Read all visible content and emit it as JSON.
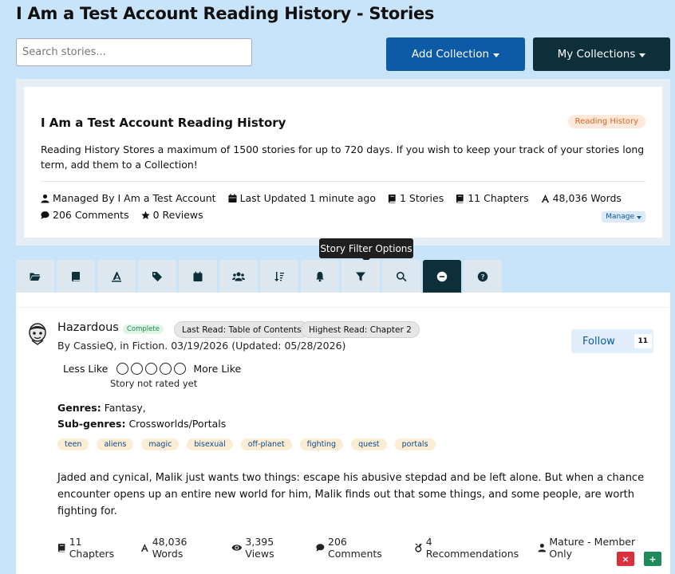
{
  "header": {
    "title": "I Am a Test Account Reading History - Stories",
    "search_placeholder": "Search stories...",
    "add_collection_label": "Add Collection",
    "my_collections_label": "My Collections"
  },
  "collection": {
    "title": "I Am a Test Account Reading History",
    "badge": "Reading History",
    "description": "Reading History Stores a maximum of 1500 stories for up to 720 days.  If you wish to keep your track of your stories long term, add them to a Collection!",
    "meta": {
      "managed_by": "Managed By I Am a Test Account",
      "last_updated": "Last Updated 1 minute ago",
      "stories": "1 Stories",
      "chapters": "11 Chapters",
      "words": "48,036 Words",
      "comments": "206 Comments",
      "reviews": "0 Reviews"
    },
    "manage_label": "Manage"
  },
  "tooltip": "Story Filter Options",
  "tabs": [
    {
      "name": "folder-icon",
      "active": false
    },
    {
      "name": "book-icon",
      "active": false
    },
    {
      "name": "quill-icon",
      "active": false
    },
    {
      "name": "tags-icon",
      "active": false
    },
    {
      "name": "calendar-icon",
      "active": false
    },
    {
      "name": "users-icon",
      "active": false
    },
    {
      "name": "sort-icon",
      "active": false
    },
    {
      "name": "bell-icon",
      "active": false
    },
    {
      "name": "filter-icon",
      "active": false
    },
    {
      "name": "search-icon",
      "active": false
    },
    {
      "name": "minus-circle-icon",
      "active": true
    },
    {
      "name": "help-icon",
      "active": false
    }
  ],
  "story": {
    "title": "Hazardous",
    "status": "Complete",
    "last_read": "Last Read: Table of Contents",
    "highest_read": "Highest Read: Chapter 2",
    "byline": "By CassieQ, in Fiction. 03/19/2026 (Updated: 05/28/2026)",
    "follow_label": "Follow",
    "follow_count": "11",
    "rating": {
      "less_like": "Less Like",
      "more_like": "More Like",
      "note": "Story not rated yet"
    },
    "genres_label": "Genres:",
    "genres_value": "Fantasy,",
    "subgenres_label": "Sub-genres:",
    "subgenres_value": "Crossworlds/Portals",
    "tags": [
      "teen",
      "aliens",
      "magic",
      "bisexual",
      "off-planet",
      "fighting",
      "quest",
      "portals"
    ],
    "synopsis": "Jaded and cynical, Malik just wants two things: escape his abusive stepdad and be left alone. But when a chance encounter opens up an entire new world for him, Malik finds out that some things, and some people, are worth fighting for.",
    "stats": {
      "chapters": "11 Chapters",
      "words": "48,036 Words",
      "views": "3,395 Views",
      "comments": "206 Comments",
      "recommendations": "4 Recommendations",
      "rating": "Mature - Member Only"
    },
    "remove_label": "×",
    "add_label": "+"
  }
}
